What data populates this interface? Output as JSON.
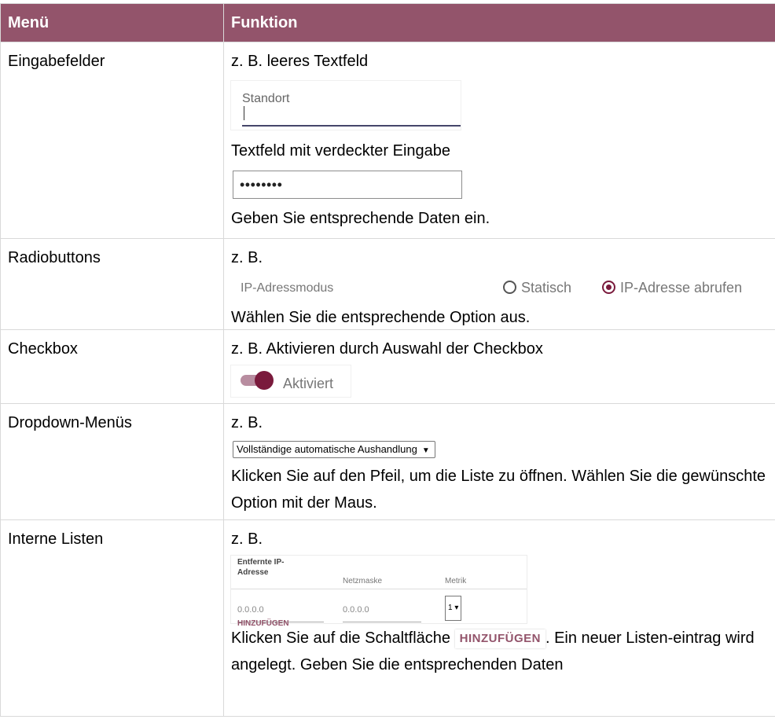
{
  "header": {
    "col_menu": "Menü",
    "col_function": "Funktion"
  },
  "rows": {
    "eingabefelder": {
      "menu": "Eingabefelder",
      "text1": "z. B. leeres Textfeld",
      "example_field_label": "Standort",
      "text2": "Textfeld mit verdeckter Eingabe",
      "password_value": "••••••••",
      "text3": "Geben Sie entsprechende Daten ein."
    },
    "radiobuttons": {
      "menu": "Radiobuttons",
      "text1": "z. B.",
      "radio_label": "IP-Adressmodus",
      "option_static": "Statisch",
      "option_fetch": "IP-Adresse abrufen",
      "text2": "Wählen Sie die entsprechende Option aus."
    },
    "checkbox": {
      "menu": "Checkbox",
      "text1": "z. B. Aktivieren durch Auswahl der Checkbox",
      "toggle_label": "Aktiviert"
    },
    "dropdown": {
      "menu": "Dropdown-Menüs",
      "text1": "z. B.",
      "select_value": "Vollständige automatische Aushandlung",
      "text2": "Klicken Sie auf den Pfeil, um die Liste zu öffnen. Wählen Sie die gewünschte Option mit der Maus."
    },
    "interne_listen": {
      "menu": "Interne Listen",
      "text1": "z. B.",
      "list_col1": "Entfernte IP-Adresse",
      "list_col2": "Netzmaske",
      "list_col3": "Metrik",
      "list_ip_placeholder": "0.0.0.0",
      "list_mask_placeholder": "0.0.0.0",
      "list_metric_value": "1",
      "list_add_label": "HINZUFÜGEN",
      "text2_before": "Klicken Sie auf die Schaltfläche",
      "button_label": "HINZUFÜGEN",
      "text2_after": ". Ein neuer Listen-eintrag wird angelegt. Geben Sie die entsprechenden Daten"
    }
  },
  "colors": {
    "header_bg": "#93546b",
    "accent": "#7a1a3c"
  }
}
